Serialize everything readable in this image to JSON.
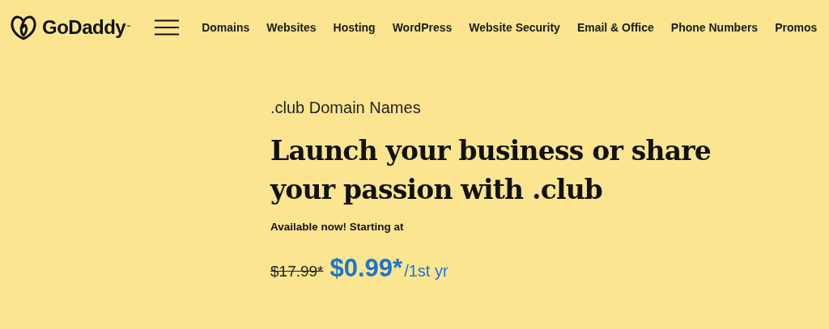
{
  "header": {
    "logo": {
      "text": "GoDaddy",
      "trademark": "™"
    },
    "nav": [
      "Domains",
      "Websites",
      "Hosting",
      "WordPress",
      "Website Security",
      "Email & Office",
      "Phone Numbers",
      "Promos"
    ]
  },
  "hero": {
    "eyebrow": ".club Domain Names",
    "headline": "Launch your business or share your passion with .club",
    "subline": "Available now! Starting at",
    "price": {
      "old": "$17.99*",
      "current": "$0.99*",
      "term": "/1st yr"
    }
  }
}
